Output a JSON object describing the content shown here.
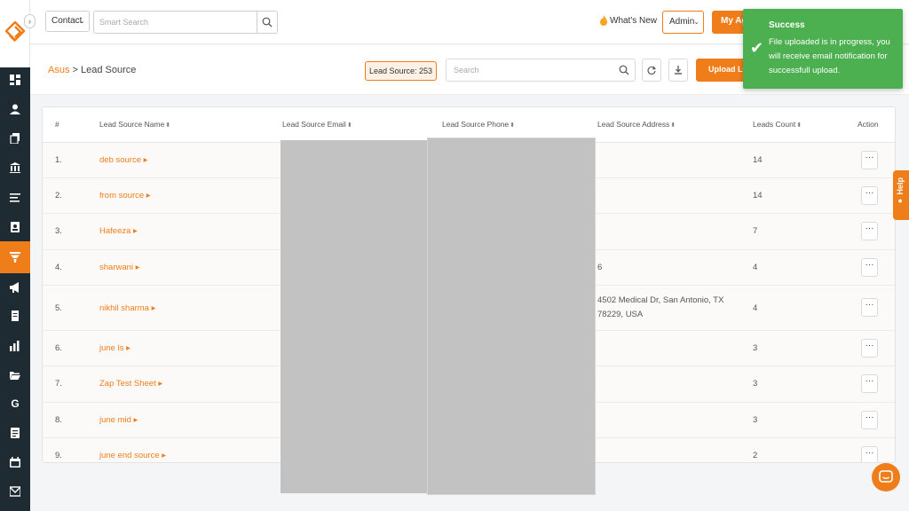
{
  "topbar": {
    "contact_select": "Contact",
    "smart_search_placeholder": "Smart Search",
    "whats_new": "What's New",
    "admin_select": "Admin",
    "my_agents": "My Ag"
  },
  "subheader": {
    "breadcrumb_root": "Asus",
    "breadcrumb_separator": ">",
    "breadcrumb_current": "Lead Source",
    "lead_count": "Lead Source: 253",
    "search_placeholder": "Search",
    "upload_button": "Upload Le"
  },
  "table": {
    "headers": {
      "index": "#",
      "name": "Lead Source Name",
      "email": "Lead Source Email",
      "phone": "Lead Source Phone",
      "address": "Lead Source Address",
      "count": "Leads Count",
      "action": "Action"
    },
    "rows": [
      {
        "index": "1.",
        "name": "deb source",
        "address": "",
        "count": "14"
      },
      {
        "index": "2.",
        "name": "from source",
        "address": "",
        "count": "14"
      },
      {
        "index": "3.",
        "name": "Hafeeza",
        "address": "",
        "count": "7"
      },
      {
        "index": "4.",
        "name": "sharwani",
        "address": "6",
        "count": "4"
      },
      {
        "index": "5.",
        "name": "nikhil sharma",
        "address": "4502 Medical Dr, San Antonio, TX 78229, USA",
        "count": "4"
      },
      {
        "index": "6.",
        "name": "june ls",
        "address": "",
        "count": "3"
      },
      {
        "index": "7.",
        "name": "Zap Test Sheet",
        "address": "",
        "count": "3"
      },
      {
        "index": "8.",
        "name": "june mid",
        "address": "",
        "count": "3"
      },
      {
        "index": "9.",
        "name": "june end source",
        "address": "",
        "count": "2"
      }
    ],
    "action_label": "···"
  },
  "toast": {
    "title": "Success",
    "message": "File uploaded is in progress, you will receive email notification for successfull upload."
  },
  "help_tab": "Help",
  "colors": {
    "accent": "#ef7d1a",
    "sidebar": "#1f2b33",
    "success": "#4caf50"
  }
}
